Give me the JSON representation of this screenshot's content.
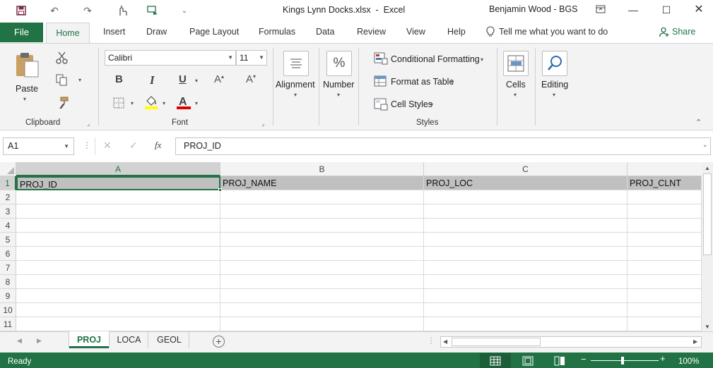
{
  "title": {
    "document": "Kings Lynn Docks.xlsx  -  Excel",
    "user": "Benjamin Wood - BGS"
  },
  "tabs": {
    "file": "File",
    "home": "Home",
    "insert": "Insert",
    "draw": "Draw",
    "page_layout": "Page Layout",
    "formulas": "Formulas",
    "data": "Data",
    "review": "Review",
    "view": "View",
    "help": "Help",
    "tell_me": "Tell me what you want to do",
    "share": "Share"
  },
  "ribbon": {
    "clipboard": {
      "paste": "Paste",
      "label": "Clipboard"
    },
    "font": {
      "name": "Calibri",
      "size": "11",
      "label": "Font",
      "bold": "B",
      "italic": "I",
      "underline": "U"
    },
    "alignment": {
      "label": "Alignment"
    },
    "number": {
      "label": "Number",
      "icon": "%"
    },
    "styles": {
      "conditional_formatting": "Conditional Formatting",
      "format_as_table": "Format as Table",
      "cell_styles": "Cell Styles",
      "label": "Styles"
    },
    "cells": {
      "label": "Cells"
    },
    "editing": {
      "label": "Editing"
    }
  },
  "formula_bar": {
    "name_box": "A1",
    "fx": "fx",
    "value": "PROJ_ID"
  },
  "grid": {
    "columns": [
      "A",
      "B",
      "C"
    ],
    "rows": [
      "1",
      "2",
      "3",
      "4",
      "5",
      "6",
      "7",
      "8",
      "9",
      "10",
      "11"
    ],
    "row1": [
      "PROJ_ID",
      "PROJ_NAME",
      "PROJ_LOC",
      "PROJ_CLNT"
    ]
  },
  "sheets": {
    "tabs": [
      "PROJ",
      "LOCA",
      "GEOL"
    ],
    "active": "PROJ"
  },
  "status": {
    "ready": "Ready",
    "zoom": "100%"
  },
  "colors": {
    "accent": "#217346",
    "header_fill": "#c0c0c0",
    "highlight_yellow": "#ffff00",
    "font_red": "#e00000"
  }
}
